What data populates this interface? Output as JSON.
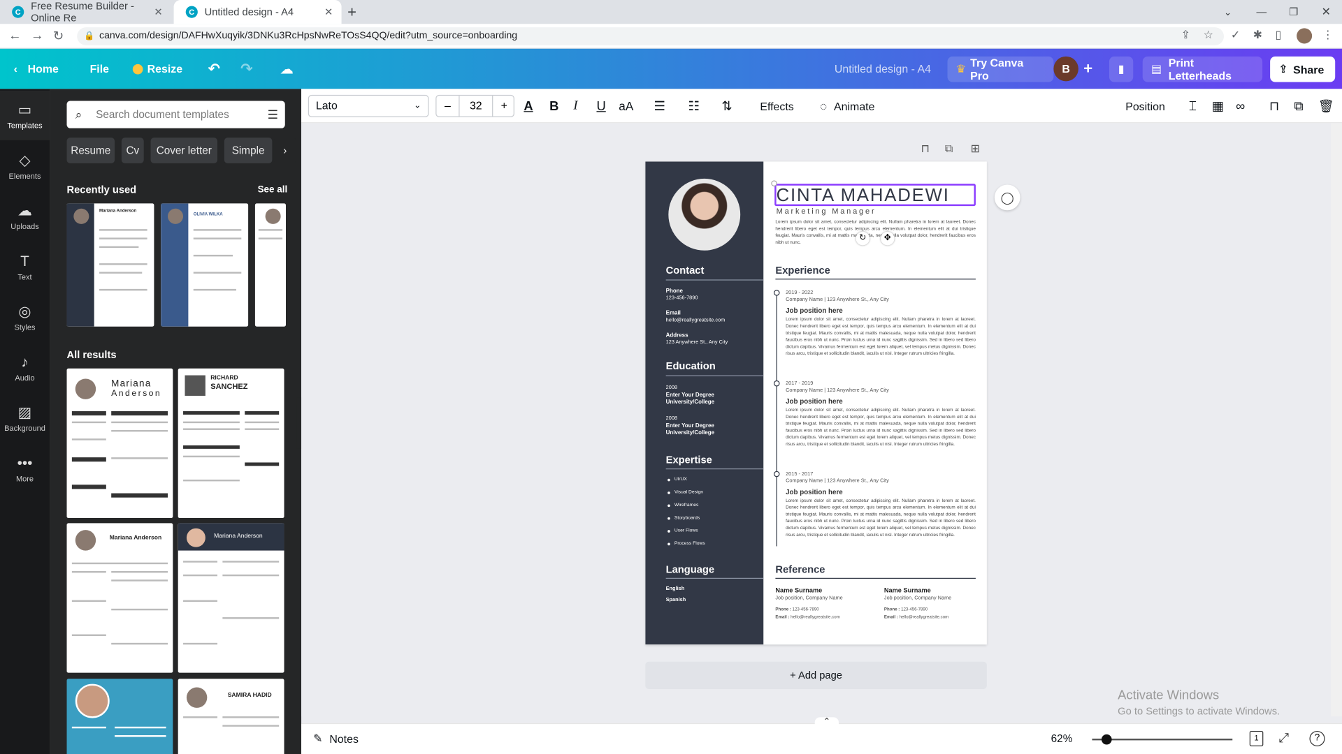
{
  "browser": {
    "tabs": [
      {
        "title": "Free Resume Builder - Online Re",
        "active": false
      },
      {
        "title": "Untitled design - A4",
        "active": true
      }
    ],
    "new_tab": "+",
    "url": "canva.com/design/DAFHwXuqyik/3DNKu3RcHpsNwReTOsS4QQ/edit?utm_source=onboarding"
  },
  "header": {
    "home": "Home",
    "file": "File",
    "resize": "Resize",
    "doc_title": "Untitled design - A4",
    "try_pro": "Try Canva Pro",
    "avatar_letter": "B",
    "print": "Print Letterheads",
    "share": "Share"
  },
  "rail": [
    {
      "label": "Templates",
      "icon": "▭"
    },
    {
      "label": "Elements",
      "icon": "◇"
    },
    {
      "label": "Uploads",
      "icon": "☁"
    },
    {
      "label": "Text",
      "icon": "T"
    },
    {
      "label": "Styles",
      "icon": "◎"
    },
    {
      "label": "Audio",
      "icon": "♪"
    },
    {
      "label": "Background",
      "icon": "▨"
    },
    {
      "label": "More",
      "icon": "•••"
    }
  ],
  "panel": {
    "search_placeholder": "Search document templates",
    "chips": [
      "Resume",
      "Cv",
      "Cover letter",
      "Simple"
    ],
    "recently_used": "Recently used",
    "see_all": "See all",
    "all_results": "All results",
    "thumb_names": [
      "Mariana Anderson",
      "OLIVIA WILKA",
      "Mariana",
      "Anderson",
      "RICHARD",
      "SANCHEZ",
      "Mariana Anderson",
      "Mariana Anderson",
      "SAMIRA HADID"
    ]
  },
  "toolbar": {
    "font": "Lato",
    "minus": "–",
    "size": "32",
    "plus": "+",
    "effects": "Effects",
    "animate": "Animate",
    "position": "Position"
  },
  "resume": {
    "name": "CINTA MAHADEWI",
    "role": "Marketing Manager",
    "summary": "Lorem ipsum dolor sit amet, consectetur adipiscing elit. Nullam pharetra in lorem at laoreet. Donec hendrerit libero eget est tempor, quis tempus arcu elementum. In elementum elit at dui tristique feugiat. Mauris convallis, mi at mattis malesuada, neque nulla volutpat dolor, hendrerit faucibus eros nibh ut nunc.",
    "contact": {
      "title": "Contact",
      "phone_label": "Phone",
      "phone": "123-456-7890",
      "email_label": "Email",
      "email": "hello@reallygreatsite.com",
      "address_label": "Address",
      "address": "123 Anywhere St., Any City"
    },
    "education": {
      "title": "Education",
      "items": [
        {
          "year": "2008",
          "degree": "Enter Your Degree",
          "school": "University/College"
        },
        {
          "year": "2008",
          "degree": "Enter Your Degree",
          "school": "University/College"
        }
      ]
    },
    "expertise": {
      "title": "Expertise",
      "items": [
        "UI/UX",
        "Visual Design",
        "Wireframes",
        "Storyboards",
        "User Flows",
        "Process Flows"
      ]
    },
    "language": {
      "title": "Language",
      "items": [
        "English",
        "Spanish"
      ]
    },
    "experience": {
      "title": "Experience",
      "items": [
        {
          "years": "2019 - 2022",
          "company": "Company Name | 123 Anywhere St., Any City",
          "position": "Job position here"
        },
        {
          "years": "2017 - 2019",
          "company": "Company Name | 123 Anywhere St., Any City",
          "position": "Job position here"
        },
        {
          "years": "2015 - 2017",
          "company": "Company Name | 123 Anywhere St., Any City",
          "position": "Job position here"
        }
      ],
      "body": "Lorem ipsum dolor sit amet, consectetur adipiscing elit. Nullam pharetra in lorem at laoreet. Donec hendrerit libero eget est tempor, quis tempus arcu elementum. In elementum elit at dui tristique feugiat. Mauris convallis, mi at mattis malesuada, neque nulla volutpat dolor, hendrerit faucibus eros nibh ut nunc. Proin luctus urna id nunc sagittis dignissim. Sed in libero sed libero dictum dapibus. Vivamus fermentum est eget lorem aliquet, vel tempus metus dignissim. Donec risus arcu, tristique et sollicitudin blandit, iaculis ut nisl. Integer rutrum ultricies fringilla."
    },
    "reference": {
      "title": "Reference",
      "items": [
        {
          "name": "Name Surname",
          "job": "Job position, Company Name",
          "phone_label": "Phone :",
          "phone": "123-456-7890",
          "email_label": "Email :",
          "email": "hello@reallygreatsite.com"
        },
        {
          "name": "Name Surname",
          "job": "Job position, Company Name",
          "phone_label": "Phone :",
          "phone": "123-456-7890",
          "email_label": "Email :",
          "email": "hello@reallygreatsite.com"
        }
      ]
    }
  },
  "canvas": {
    "add_page": "+ Add page",
    "activate_title": "Activate Windows",
    "activate_sub": "Go to Settings to activate Windows."
  },
  "bottom": {
    "notes": "Notes",
    "zoom": "62%"
  },
  "colors": {
    "accent": "#8b3dff",
    "sidebar_dark": "#323846",
    "canva_teal": "#00c4cc"
  }
}
